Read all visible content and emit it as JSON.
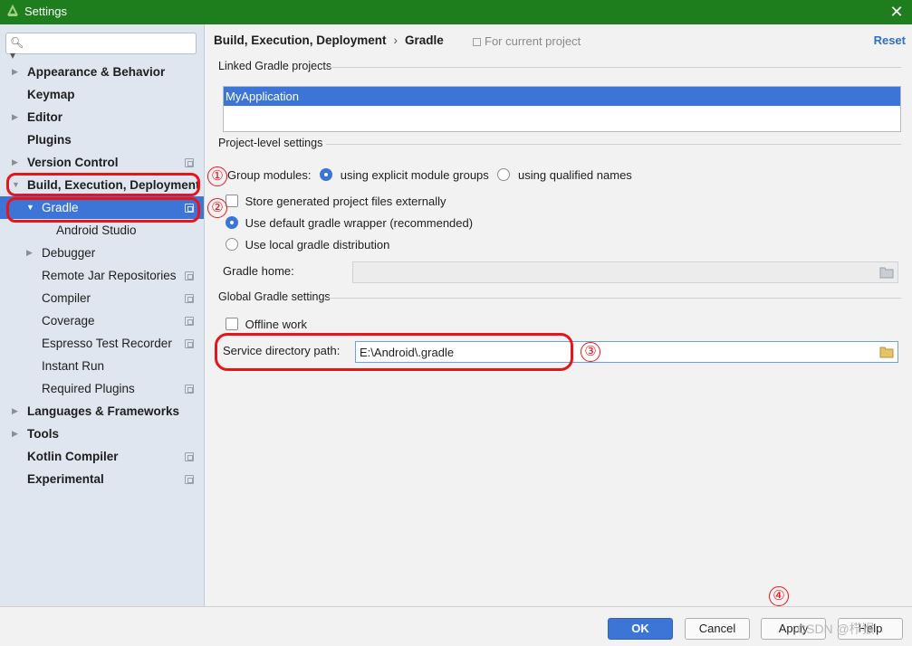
{
  "window": {
    "title": "Settings",
    "titlebar_color": "#1e7e1e"
  },
  "sidebar": {
    "search_placeholder": "",
    "items": [
      {
        "label": "Appearance & Behavior"
      },
      {
        "label": "Keymap"
      },
      {
        "label": "Editor"
      },
      {
        "label": "Plugins"
      },
      {
        "label": "Version Control"
      },
      {
        "label": "Build, Execution, Deployment"
      },
      {
        "label": "Gradle"
      },
      {
        "label": "Android Studio"
      },
      {
        "label": "Debugger"
      },
      {
        "label": "Remote Jar Repositories"
      },
      {
        "label": "Compiler"
      },
      {
        "label": "Coverage"
      },
      {
        "label": "Espresso Test Recorder"
      },
      {
        "label": "Instant Run"
      },
      {
        "label": "Required Plugins"
      },
      {
        "label": "Languages & Frameworks"
      },
      {
        "label": "Tools"
      },
      {
        "label": "Kotlin Compiler"
      },
      {
        "label": "Experimental"
      }
    ]
  },
  "header": {
    "breadcrumb_parent": "Build, Execution, Deployment",
    "breadcrumb_sep": "›",
    "breadcrumb_current": "Gradle",
    "for_current_project": "For current project",
    "reset": "Reset"
  },
  "linked": {
    "title": "Linked Gradle projects",
    "projects": [
      "MyApplication"
    ]
  },
  "project_level": {
    "title": "Project-level settings",
    "group_modules_label": "Group modules:",
    "option_explicit": "using explicit module groups",
    "option_qualified": "using qualified names",
    "store_externally": "Store generated project files externally",
    "use_default_wrapper": "Use default gradle wrapper (recommended)",
    "use_local": "Use local gradle distribution",
    "gradle_home_label": "Gradle home:",
    "gradle_home_value": ""
  },
  "global": {
    "title": "Global Gradle settings",
    "offline_work": "Offline work",
    "service_dir_label": "Service directory path:",
    "service_dir_value": "E:\\Android\\.gradle"
  },
  "annotations": [
    "①",
    "②",
    "③",
    "④"
  ],
  "annotation_color": "#e8141c",
  "footer": {
    "ok": "OK",
    "cancel": "Cancel",
    "apply": "Apply",
    "help": "Help",
    "watermark": "CSDN @栉猴"
  },
  "accent_color": "#3d75d6"
}
